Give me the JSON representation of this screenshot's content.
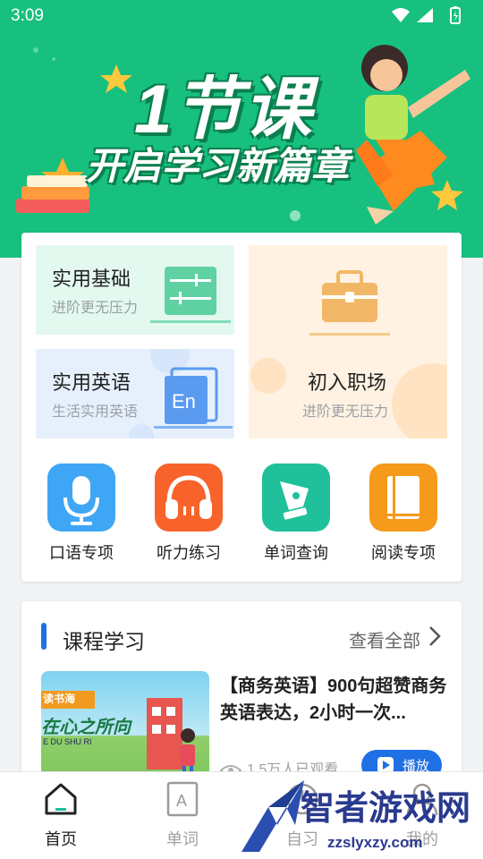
{
  "status": {
    "time": "3:09"
  },
  "banner": {
    "line1": "1节课",
    "line2": "开启学习新篇章"
  },
  "tiles": [
    {
      "title": "实用基础",
      "subtitle": "进阶更无压力",
      "icon": "equalizer-board-icon"
    },
    {
      "title": "实用英语",
      "subtitle": "生活实用英语",
      "icon": "en-card-icon"
    },
    {
      "title": "初入职场",
      "subtitle": "进阶更无压力",
      "icon": "briefcase-icon"
    }
  ],
  "features": [
    {
      "label": "口语专项",
      "icon": "microphone-icon",
      "color": "#3ea6f5"
    },
    {
      "label": "听力练习",
      "icon": "headphones-icon",
      "color": "#f7632a"
    },
    {
      "label": "单词查询",
      "icon": "pen-nib-icon",
      "color": "#1fc09a"
    },
    {
      "label": "阅读专项",
      "icon": "book-icon",
      "color": "#f59a1a"
    }
  ],
  "course_section": {
    "title": "课程学习",
    "see_all": "查看全部",
    "item": {
      "title": "【商务英语】900句超赞商务英语表达，2小时一次...",
      "views": "1.5万人已观看",
      "play": "播放",
      "thumb_text": "在心之所向",
      "thumb_sub": "E DU SHU RI",
      "thumb_tag": "读书海"
    }
  },
  "tabs": [
    {
      "label": "首页",
      "icon": "home-icon",
      "active": true
    },
    {
      "label": "单词",
      "icon": "word-card-icon",
      "active": false
    },
    {
      "label": "自习",
      "icon": "clock-icon",
      "active": false
    },
    {
      "label": "我的",
      "icon": "user-icon",
      "active": false
    }
  ],
  "watermark": {
    "brand": "智者游戏网",
    "url": "zzsIyxzy.com"
  },
  "colors": {
    "brand_green": "#17c07e",
    "accent_blue": "#1f6fe5"
  }
}
